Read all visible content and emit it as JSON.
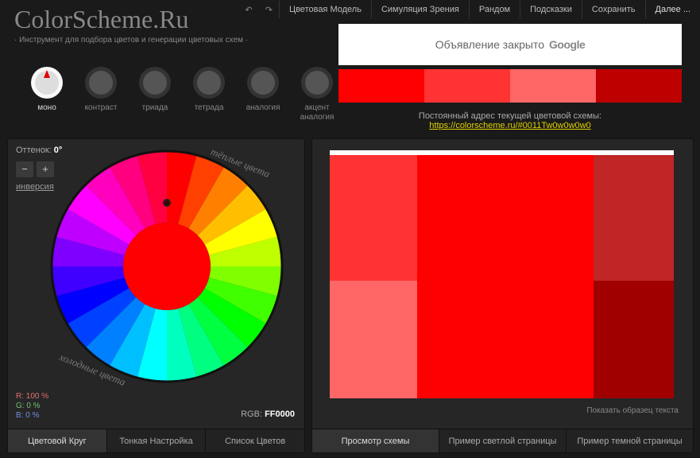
{
  "topbar": {
    "undo": "↶",
    "redo": "↷",
    "items": [
      "Цветовая Модель",
      "Симуляция Зрения",
      "Рандом",
      "Подсказки",
      "Сохранить",
      "Далее ..."
    ]
  },
  "header": {
    "logo": "ColorScheme.Ru",
    "subtitle": "· Инструмент для подбора цветов и генерации цветовых схем ·"
  },
  "schemes": [
    {
      "label": "моно",
      "active": true
    },
    {
      "label": "контраст",
      "active": false
    },
    {
      "label": "триада",
      "active": false
    },
    {
      "label": "тетрада",
      "active": false
    },
    {
      "label": "аналогия",
      "active": false
    },
    {
      "label": "акцент\nаналогия",
      "active": false
    }
  ],
  "leftPanel": {
    "hue_label": "Оттенок:",
    "hue_value": "0°",
    "minus": "−",
    "plus": "+",
    "inversion": "инверсия",
    "warm": "тёплые цвета",
    "cold": "холодные цвета",
    "rgb_r": "R: 100 %",
    "rgb_g": "G:    0 %",
    "rgb_b": "B:    0 %",
    "rgb_label": "RGB:",
    "rgb_code": "FF0000",
    "tabs": [
      "Цветовой Круг",
      "Тонкая Настройка",
      "Список Цветов"
    ]
  },
  "ad": {
    "text": "Объявление закрыто",
    "brand": "Google"
  },
  "swatches": [
    "#ff0000",
    "#ff3333",
    "#ff6666",
    "#bf0000"
  ],
  "permalink": {
    "label": "Постоянный адрес текущей цветовой схемы:",
    "url": "https://colorscheme.ru/#0011Tw0w0w0w0"
  },
  "rightPanel": {
    "preview_colors": {
      "top_bar": "#ffffff",
      "cells": [
        "#ff3333",
        "#ff0000",
        "#c02626",
        "#ff6666",
        "#ff0000",
        "#a00000"
      ]
    },
    "sample_text": "Показать образец текста",
    "tabs": [
      "Просмотр схемы",
      "Пример светлой страницы",
      "Пример темной страницы"
    ]
  }
}
